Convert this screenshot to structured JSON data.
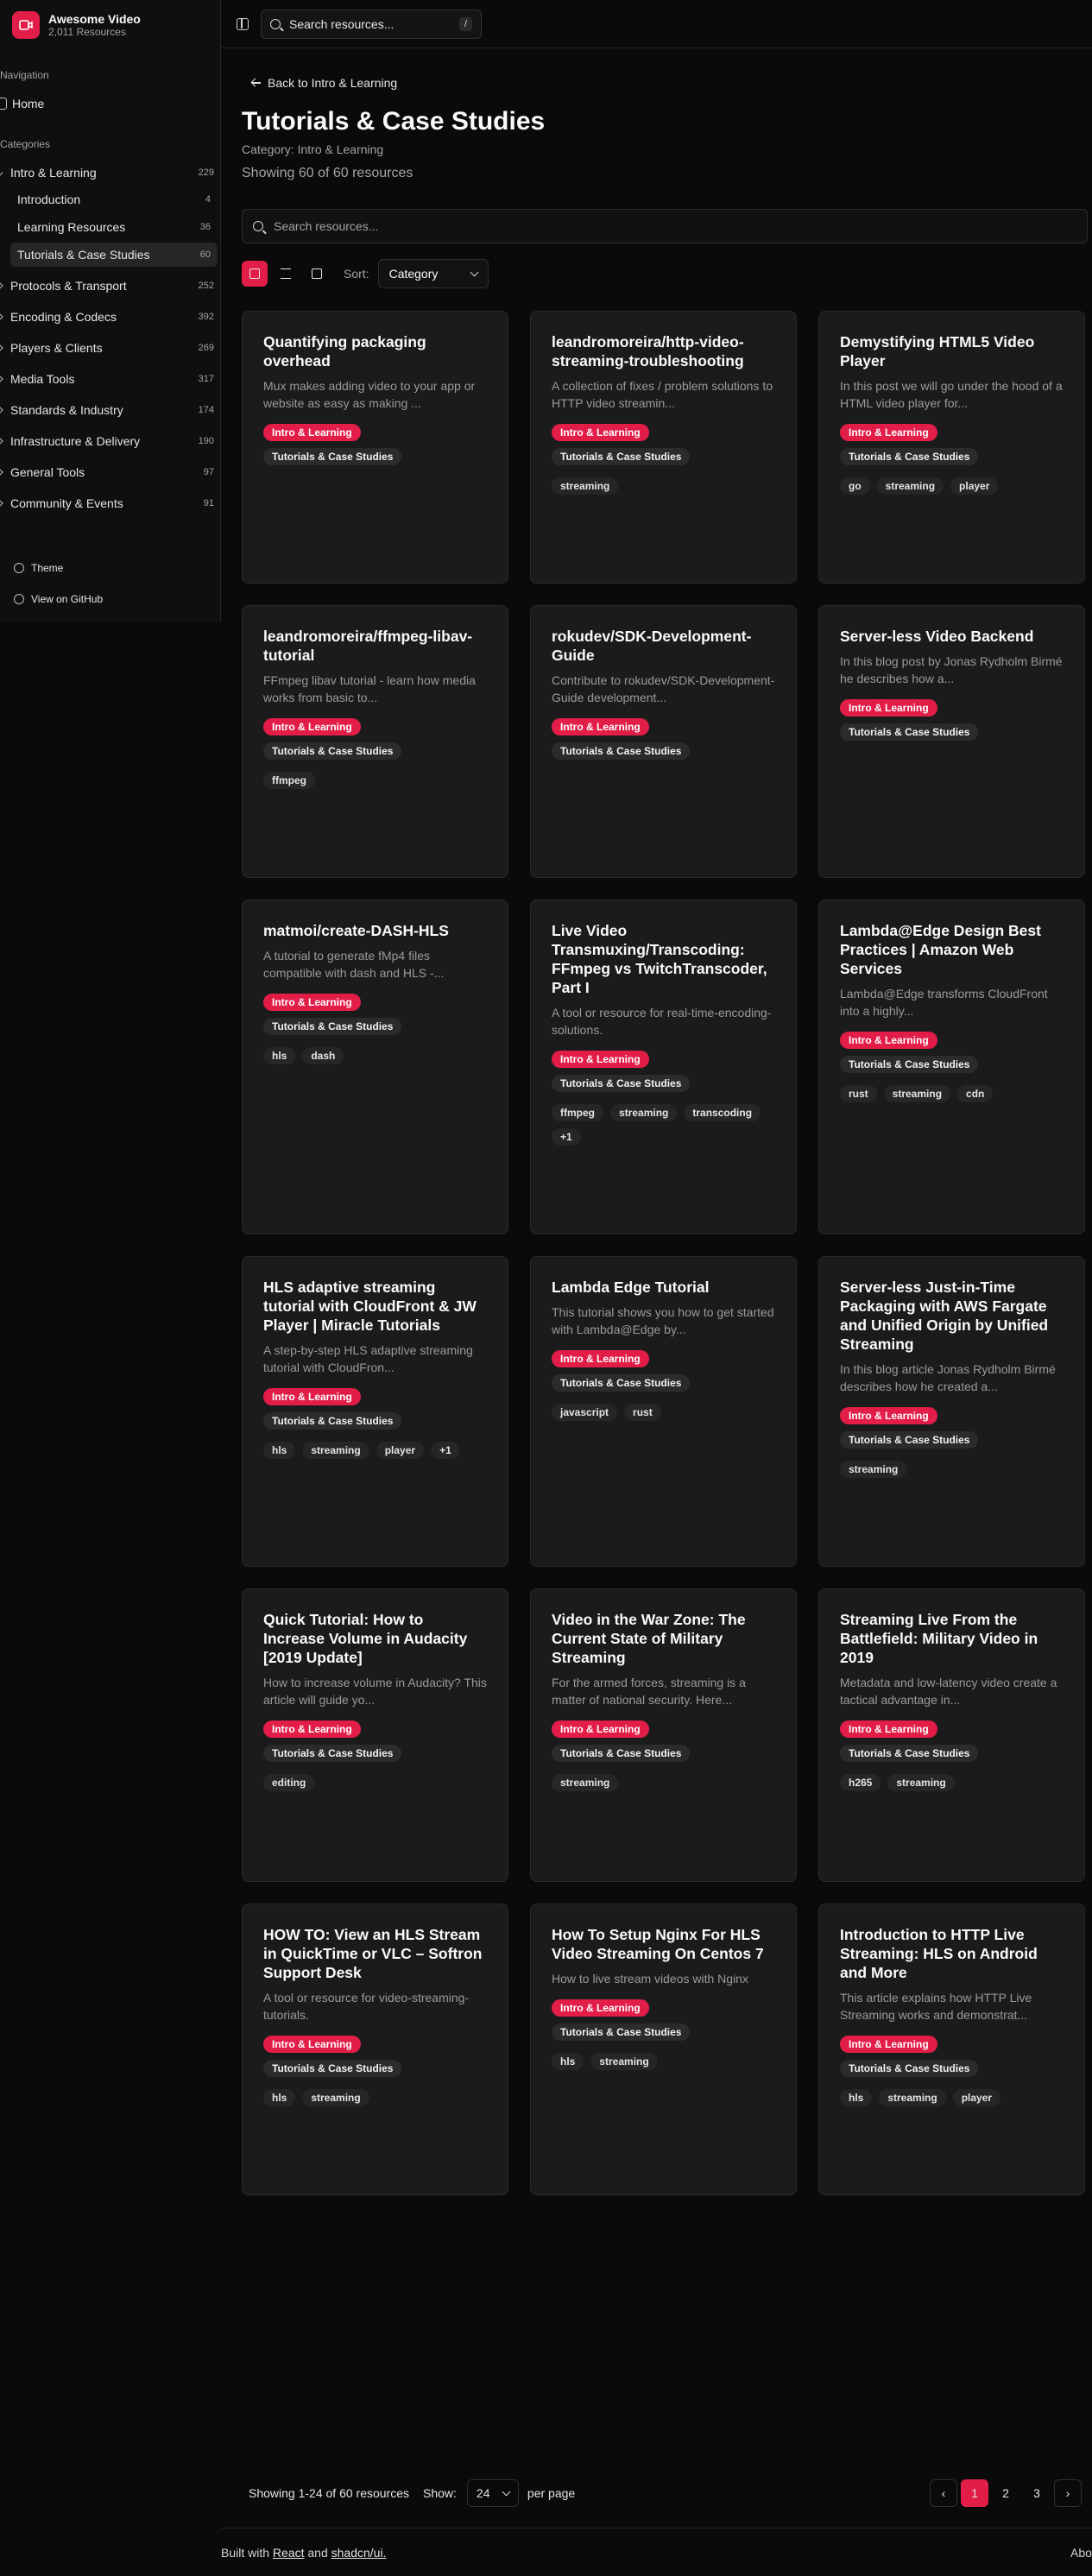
{
  "brand": {
    "title": "Awesome Video",
    "subtitle": "2,011 Resources"
  },
  "sidebar": {
    "nav_label": "Navigation",
    "home": "Home",
    "categories_label": "Categories",
    "items": [
      {
        "label": "Intro & Learning",
        "count": "229"
      },
      {
        "label": "Introduction",
        "count": "4"
      },
      {
        "label": "Learning Resources",
        "count": "36"
      },
      {
        "label": "Tutorials & Case Studies",
        "count": "60"
      },
      {
        "label": "Protocols & Transport",
        "count": "252"
      },
      {
        "label": "Encoding & Codecs",
        "count": "392"
      },
      {
        "label": "Players & Clients",
        "count": "269"
      },
      {
        "label": "Media Tools",
        "count": "317"
      },
      {
        "label": "Standards & Industry",
        "count": "174"
      },
      {
        "label": "Infrastructure & Delivery",
        "count": "190"
      },
      {
        "label": "General Tools",
        "count": "97"
      },
      {
        "label": "Community & Events",
        "count": "91"
      }
    ],
    "theme": "Theme",
    "github": "View on GitHub"
  },
  "topbar": {
    "search_placeholder": "Search resources...",
    "shortcut": "/"
  },
  "page": {
    "back": "Back to Intro & Learning",
    "title": "Tutorials & Case Studies",
    "category": "Category: Intro & Learning",
    "showing": "Showing 60 of 60 resources",
    "search_placeholder": "Search resources...",
    "sort_label": "Sort:",
    "sort_value": "Category"
  },
  "cards": [
    {
      "title": "Quantifying packaging overhead",
      "desc": "Mux makes adding video to your app or website as easy as making ...",
      "badge": "Intro & Learning",
      "badge2": "Tutorials & Case Studies",
      "tags": []
    },
    {
      "title": "leandromoreira/http-video-streaming-troubleshooting",
      "desc": "A collection of fixes / problem solutions to HTTP video streamin...",
      "badge": "Intro & Learning",
      "badge2": "Tutorials & Case Studies",
      "tags": [
        "streaming"
      ]
    },
    {
      "title": "Demystifying HTML5 Video Player",
      "desc": "In this post we will go under the hood of a HTML video player for...",
      "badge": "Intro & Learning",
      "badge2": "Tutorials & Case Studies",
      "tags": [
        "go",
        "streaming",
        "player"
      ]
    },
    {
      "title": "leandromoreira/ffmpeg-libav-tutorial",
      "desc": "FFmpeg libav tutorial - learn how media works from basic to...",
      "badge": "Intro & Learning",
      "badge2": "Tutorials & Case Studies",
      "tags": [
        "ffmpeg"
      ]
    },
    {
      "title": "rokudev/SDK-Development-Guide",
      "desc": "Contribute to rokudev/SDK-Development-Guide development...",
      "badge": "Intro & Learning",
      "badge2": "Tutorials & Case Studies",
      "tags": []
    },
    {
      "title": "Server-less Video Backend",
      "desc": "In this blog post by Jonas Rydholm Birmé he describes how a...",
      "badge": "Intro & Learning",
      "badge2": "Tutorials & Case Studies",
      "tags": []
    },
    {
      "title": "matmoi/create-DASH-HLS",
      "desc": "A tutorial to generate fMp4 files compatible with dash and HLS -...",
      "badge": "Intro & Learning",
      "badge2": "Tutorials & Case Studies",
      "tags": [
        "hls",
        "dash"
      ]
    },
    {
      "title": "Live Video Transmuxing/Transcoding: FFmpeg vs TwitchTranscoder, Part I",
      "desc": "A tool or resource for real-time-encoding-solutions.",
      "badge": "Intro & Learning",
      "badge2": "Tutorials & Case Studies",
      "tags": [
        "ffmpeg",
        "streaming",
        "transcoding",
        "+1"
      ]
    },
    {
      "title": "Lambda@Edge Design Best Practices | Amazon Web Services",
      "desc": "Lambda@Edge transforms CloudFront into a highly...",
      "badge": "Intro & Learning",
      "badge2": "Tutorials & Case Studies",
      "tags": [
        "rust",
        "streaming",
        "cdn"
      ]
    },
    {
      "title": "HLS adaptive streaming tutorial with CloudFront & JW Player | Miracle Tutorials",
      "desc": "A step-by-step HLS adaptive streaming tutorial with CloudFron...",
      "badge": "Intro & Learning",
      "badge2": "Tutorials & Case Studies",
      "tags": [
        "hls",
        "streaming",
        "player",
        "+1"
      ]
    },
    {
      "title": "Lambda Edge Tutorial",
      "desc": "This tutorial shows you how to get started with Lambda@Edge by...",
      "badge": "Intro & Learning",
      "badge2": "Tutorials & Case Studies",
      "tags": [
        "javascript",
        "rust"
      ]
    },
    {
      "title": "Server-less Just-in-Time Packaging with AWS Fargate and Unified Origin by Unified Streaming",
      "desc": "In this blog article Jonas Rydholm Birmé describes how he created a...",
      "badge": "Intro & Learning",
      "badge2": "Tutorials & Case Studies",
      "tags": [
        "streaming"
      ]
    },
    {
      "title": "Quick Tutorial: How to Increase Volume in Audacity [2019 Update]",
      "desc": "How to increase volume in Audacity? This article will guide yo...",
      "badge": "Intro & Learning",
      "badge2": "Tutorials & Case Studies",
      "tags": [
        "editing"
      ]
    },
    {
      "title": "Video in the War Zone: The Current State of Military Streaming",
      "desc": "For the armed forces, streaming is a matter of national security. Here...",
      "badge": "Intro & Learning",
      "badge2": "Tutorials & Case Studies",
      "tags": [
        "streaming"
      ]
    },
    {
      "title": "Streaming Live From the Battlefield: Military Video in 2019",
      "desc": "Metadata and low-latency video create a tactical advantage in...",
      "badge": "Intro & Learning",
      "badge2": "Tutorials & Case Studies",
      "tags": [
        "h265",
        "streaming"
      ]
    },
    {
      "title": "HOW TO: View an HLS Stream in QuickTime or VLC – Softron Support Desk",
      "desc": "A tool or resource for video-streaming-tutorials.",
      "badge": "Intro & Learning",
      "badge2": "Tutorials & Case Studies",
      "tags": [
        "hls",
        "streaming"
      ]
    },
    {
      "title": "How To Setup Nginx For HLS Video Streaming On Centos 7",
      "desc": "How to live stream videos with Nginx",
      "badge": "Intro & Learning",
      "badge2": "Tutorials & Case Studies",
      "tags": [
        "hls",
        "streaming"
      ]
    },
    {
      "title": "Introduction to HTTP Live Streaming: HLS on Android and More",
      "desc": "This article explains how HTTP Live Streaming works and demonstrat...",
      "badge": "Intro & Learning",
      "badge2": "Tutorials & Case Studies",
      "tags": [
        "hls",
        "streaming",
        "player"
      ]
    }
  ],
  "pager": {
    "showing": "Showing 1-24 of 60 resources",
    "show_label": "Show:",
    "per_page_value": "24",
    "per_page_label": "per page",
    "pages": [
      "1",
      "2",
      "3"
    ],
    "prev": "‹",
    "next": "›"
  },
  "footer": {
    "built": "Built with",
    "react": "React",
    "and": "and",
    "shadcn": "shadcn/ui.",
    "about": "About"
  },
  "colors": {
    "accent": "#e11d48",
    "bg": "#0a0a0a",
    "card": "#1c1b1b"
  }
}
